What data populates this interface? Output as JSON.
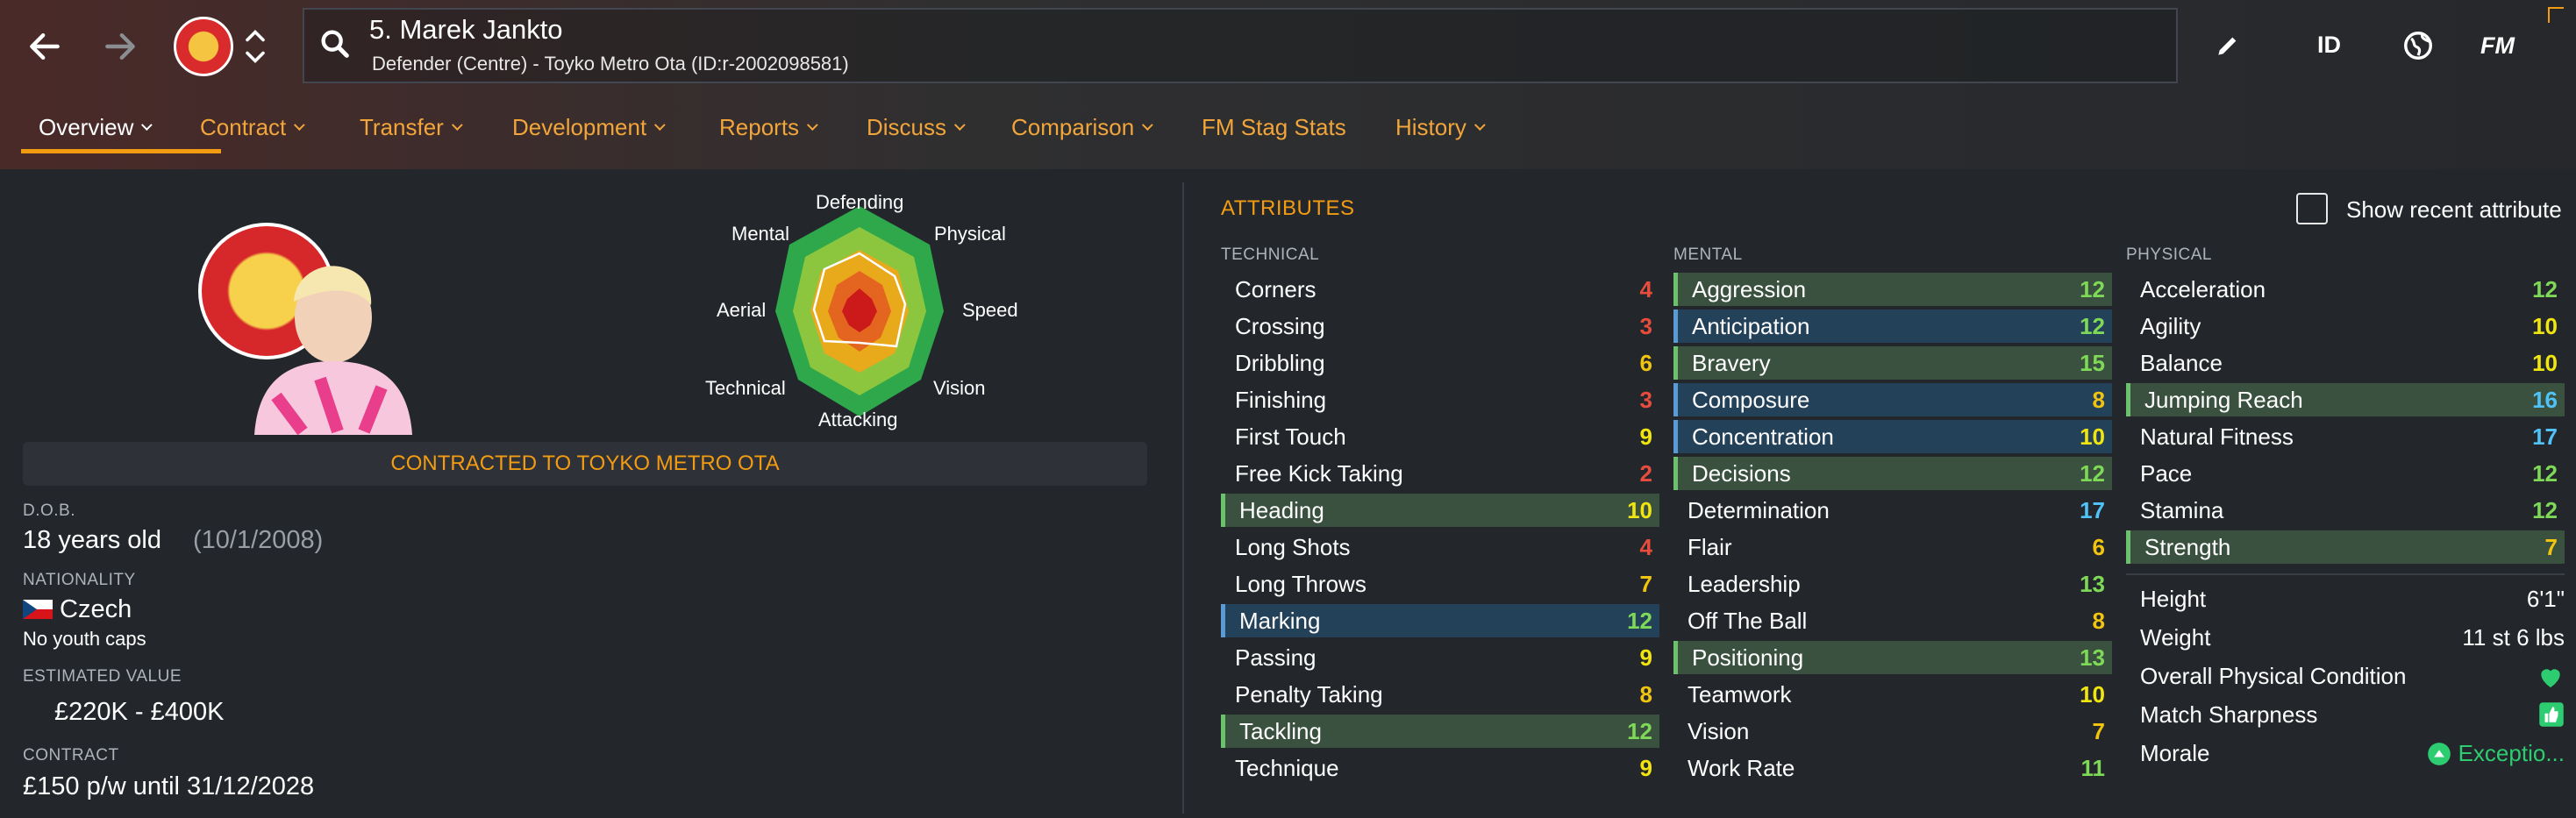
{
  "header": {
    "player_name": "5. Marek Jankto",
    "player_subtitle": "Defender (Centre) - Toyko Metro Ota (ID:r-2002098581)",
    "id_button": "ID",
    "fm_button": "FM"
  },
  "tabs": [
    {
      "label": "Overview"
    },
    {
      "label": "Contract"
    },
    {
      "label": "Transfer"
    },
    {
      "label": "Development"
    },
    {
      "label": "Reports"
    },
    {
      "label": "Discuss"
    },
    {
      "label": "Comparison"
    },
    {
      "label": "FM Stag Stats"
    },
    {
      "label": "History"
    }
  ],
  "radar": {
    "labels": [
      "Defending",
      "Physical",
      "Speed",
      "Vision",
      "Attacking",
      "Technical",
      "Aerial",
      "Mental"
    ]
  },
  "profile": {
    "contract_banner": "CONTRACTED TO TOYKO METRO OTA",
    "dob_label": "D.O.B.",
    "age": "18 years old",
    "dob": "(10/1/2008)",
    "nationality_label": "NATIONALITY",
    "nationality": "Czech",
    "youth_caps": "No youth caps",
    "value_label": "ESTIMATED VALUE",
    "value": "£220K - £400K",
    "contract_label": "CONTRACT",
    "contract": "£150 p/w until 31/12/2028"
  },
  "attributes": {
    "title": "ATTRIBUTES",
    "show_recent_label": "Show recent attribute",
    "technical_label": "TECHNICAL",
    "mental_label": "MENTAL",
    "physical_label": "PHYSICAL",
    "technical": [
      {
        "name": "Corners",
        "value": "4"
      },
      {
        "name": "Crossing",
        "value": "3"
      },
      {
        "name": "Dribbling",
        "value": "6"
      },
      {
        "name": "Finishing",
        "value": "3"
      },
      {
        "name": "First Touch",
        "value": "9"
      },
      {
        "name": "Free Kick Taking",
        "value": "2"
      },
      {
        "name": "Heading",
        "value": "10"
      },
      {
        "name": "Long Shots",
        "value": "4"
      },
      {
        "name": "Long Throws",
        "value": "7"
      },
      {
        "name": "Marking",
        "value": "12"
      },
      {
        "name": "Passing",
        "value": "9"
      },
      {
        "name": "Penalty Taking",
        "value": "8"
      },
      {
        "name": "Tackling",
        "value": "12"
      },
      {
        "name": "Technique",
        "value": "9"
      }
    ],
    "mental": [
      {
        "name": "Aggression",
        "value": "12"
      },
      {
        "name": "Anticipation",
        "value": "12"
      },
      {
        "name": "Bravery",
        "value": "15"
      },
      {
        "name": "Composure",
        "value": "8"
      },
      {
        "name": "Concentration",
        "value": "10"
      },
      {
        "name": "Decisions",
        "value": "12"
      },
      {
        "name": "Determination",
        "value": "17"
      },
      {
        "name": "Flair",
        "value": "6"
      },
      {
        "name": "Leadership",
        "value": "13"
      },
      {
        "name": "Off The Ball",
        "value": "8"
      },
      {
        "name": "Positioning",
        "value": "13"
      },
      {
        "name": "Teamwork",
        "value": "10"
      },
      {
        "name": "Vision",
        "value": "7"
      },
      {
        "name": "Work Rate",
        "value": "11"
      }
    ],
    "physical": [
      {
        "name": "Acceleration",
        "value": "12"
      },
      {
        "name": "Agility",
        "value": "10"
      },
      {
        "name": "Balance",
        "value": "10"
      },
      {
        "name": "Jumping Reach",
        "value": "16"
      },
      {
        "name": "Natural Fitness",
        "value": "17"
      },
      {
        "name": "Pace",
        "value": "12"
      },
      {
        "name": "Stamina",
        "value": "12"
      },
      {
        "name": "Strength",
        "value": "7"
      }
    ]
  },
  "physical_info": {
    "height_label": "Height",
    "height": "6'1\"",
    "weight_label": "Weight",
    "weight": "11 st 6 lbs",
    "condition_label": "Overall Physical Condition",
    "sharpness_label": "Match Sharpness",
    "morale_label": "Morale",
    "morale": "Exceptio..."
  },
  "colors": {
    "accent": "#f39c12",
    "green": "#7ed957",
    "red": "#e74c3c",
    "yellow": "#f1c40f",
    "cyan": "#4fc3f7"
  }
}
